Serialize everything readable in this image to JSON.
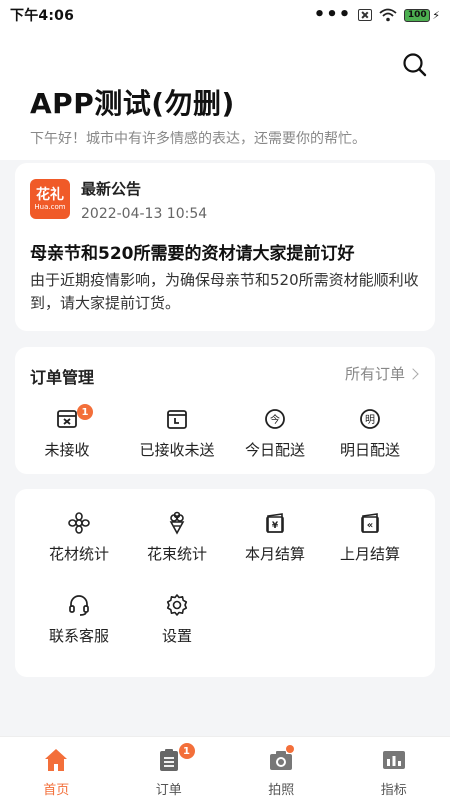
{
  "status_bar": {
    "time": "下午4:06",
    "dots": "•••",
    "battery": "100"
  },
  "header": {
    "title": "APP测试(勿删)",
    "subtitle": "下午好！城市中有许多情感的表达，还需要你的帮忙。"
  },
  "notice": {
    "logo_big": "花礼",
    "logo_small": "Hua.com",
    "label": "最新公告",
    "date": "2022-04-13 10:54",
    "heading": "母亲节和520所需要的资材请大家提前订好",
    "body": "由于近期疫情影响，为确保母亲节和520所需资材能顺利收到，请大家提前订货。"
  },
  "orders": {
    "title": "订单管理",
    "all_label": "所有订单",
    "items": [
      {
        "label": "未接收",
        "icon": "box-x-icon",
        "badge": "1"
      },
      {
        "label": "已接收未送",
        "icon": "calendar-box-icon"
      },
      {
        "label": "今日配送",
        "icon": "today-delivery-icon",
        "glyph": "今"
      },
      {
        "label": "明日配送",
        "icon": "tomorrow-delivery-icon",
        "glyph": "明"
      }
    ]
  },
  "tools": {
    "items": [
      {
        "label": "花材统计",
        "icon": "flower-icon"
      },
      {
        "label": "花束统计",
        "icon": "bouquet-icon"
      },
      {
        "label": "本月结算",
        "icon": "yen-wallet-icon",
        "glyph": "¥"
      },
      {
        "label": "上月结算",
        "icon": "previous-wallet-icon",
        "glyph": "«"
      },
      {
        "label": "联系客服",
        "icon": "headset-icon"
      },
      {
        "label": "设置",
        "icon": "gear-icon"
      }
    ]
  },
  "tabbar": {
    "items": [
      {
        "label": "首页",
        "icon": "home-icon",
        "active": true
      },
      {
        "label": "订单",
        "icon": "order-list-icon",
        "badge": "1"
      },
      {
        "label": "拍照",
        "icon": "camera-icon"
      },
      {
        "label": "指标",
        "icon": "chart-icon"
      }
    ]
  },
  "colors": {
    "accent": "#f36f3a",
    "logo_bg": "#f05a28",
    "background": "#f4f5f7"
  }
}
